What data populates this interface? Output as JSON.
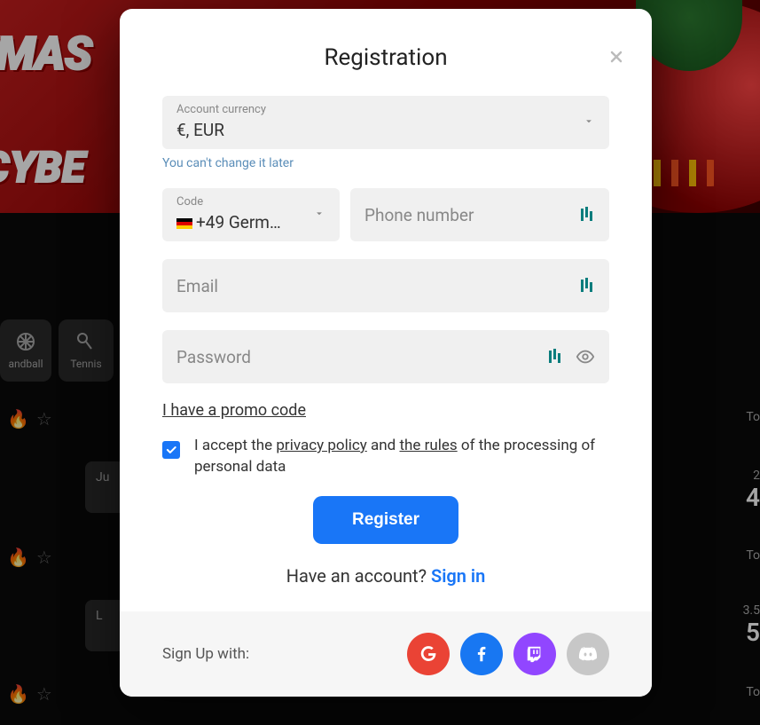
{
  "bg": {
    "banner_line1": "ISTMAS",
    "banner_line2": "CYBE",
    "handball_label": "andball",
    "tennis_label": "Tennis",
    "row1_card": "Ju",
    "row2_card": "L",
    "right_to": "To",
    "right_r1_sub": "2",
    "right_r1_num": "4",
    "right_r2_sub": "3.5",
    "right_r2_num": "5"
  },
  "modal": {
    "title": "Registration",
    "currency": {
      "label": "Account currency",
      "value": "€, EUR",
      "hint": "You can't change it later"
    },
    "code": {
      "label": "Code",
      "value": "+49 Germ…"
    },
    "phone_placeholder": "Phone number",
    "email_placeholder": "Email",
    "password_placeholder": "Password",
    "promo_link": "I have a promo code",
    "consent_prefix": "I accept the ",
    "consent_privacy": "privacy policy",
    "consent_and": " and ",
    "consent_rules": "the rules",
    "consent_suffix": " of the processing of personal data",
    "register_btn": "Register",
    "have_account": "Have an account? ",
    "signin": "Sign in",
    "signup_with": "Sign Up with:"
  }
}
